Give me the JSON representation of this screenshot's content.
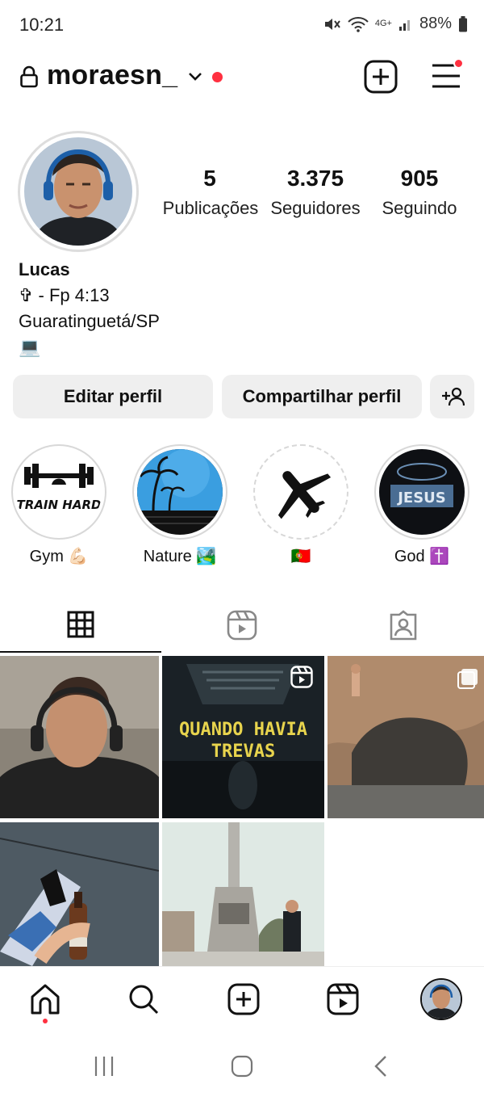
{
  "status": {
    "time": "10:21",
    "network": "4G+",
    "battery": "88%"
  },
  "header": {
    "username": "moraesn_"
  },
  "profile": {
    "stats": [
      {
        "value": "5",
        "label": "Publicações"
      },
      {
        "value": "3.375",
        "label": "Seguidores"
      },
      {
        "value": "905",
        "label": "Seguindo"
      }
    ],
    "bio": {
      "name": "Lucas",
      "line1": "✞ - Fp 4:13",
      "line2": "Guaratinguetá/SP",
      "line3": "💻"
    }
  },
  "actions": {
    "edit": "Editar perfil",
    "share": "Compartilhar perfil"
  },
  "highlights": [
    {
      "label": "Gym 💪🏻",
      "cover_text": "TRAIN HARD"
    },
    {
      "label": "Nature 🏞️"
    },
    {
      "label": "🇵🇹"
    },
    {
      "label": "God ✝️",
      "cover_text": "JESUS"
    }
  ],
  "posts": {
    "reel_text": "QUANDO HAVIA TREVAS"
  },
  "colors": {
    "notification": "#ff3040",
    "button_bg": "#efefef"
  },
  "icons": {
    "header": [
      "lock-icon",
      "chevron-down-icon",
      "new-post-icon",
      "menu-icon"
    ],
    "tabs": [
      "grid-icon",
      "reels-icon",
      "tagged-icon"
    ],
    "nav": [
      "home-icon",
      "search-icon",
      "create-icon",
      "reels-icon",
      "profile-avatar"
    ],
    "android": [
      "recent-apps-icon",
      "home-button-icon",
      "back-icon"
    ]
  }
}
